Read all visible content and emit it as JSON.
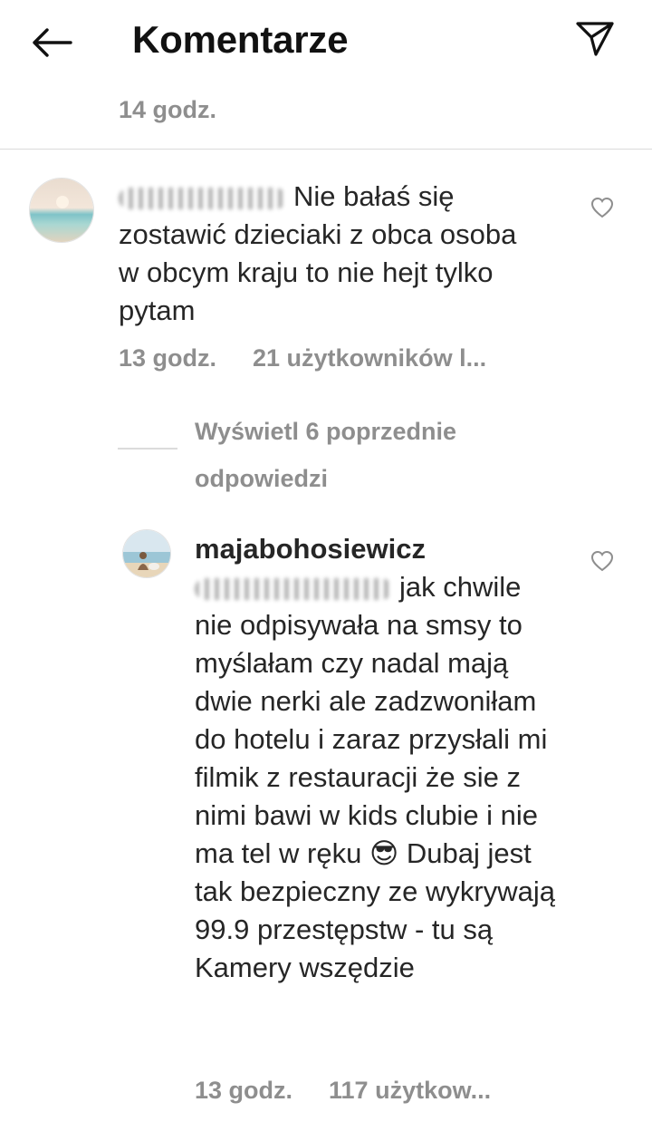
{
  "header": {
    "title": "Komentarze",
    "back_icon": "arrow-left-icon",
    "send_icon": "paper-plane-icon"
  },
  "post": {
    "time": "14 godz."
  },
  "comment1": {
    "username_blurred": "",
    "text": "Nie bałaś się zostawić dzieciaki z obca osoba w obcym kraju to nie hejt tylko  pytam",
    "time": "13 godz.",
    "likes": "21 użytkowników l..."
  },
  "replies": {
    "view_label": "Wyświetl 6 poprzednie odpowiedzi"
  },
  "reply1": {
    "username": "majabohosiewicz",
    "mention_blurred": "",
    "text": "jak chwile nie odpisywała na smsy to myślałam czy nadal mają dwie nerki ale zadzwoniłam do hotelu i zaraz przysłali mi filmik z restauracji że sie z nimi bawi w kids clubie i nie ma tel w ręku 😎 Dubaj jest tak bezpieczny ze wykrywają 99.9 przestępstw - tu są Kamery wszędzie",
    "time": "13 godz.",
    "likes": "117 użytkow..."
  },
  "colors": {
    "text": "#262626",
    "secondary": "#8e8e8e",
    "divider": "#dbdbdb"
  }
}
